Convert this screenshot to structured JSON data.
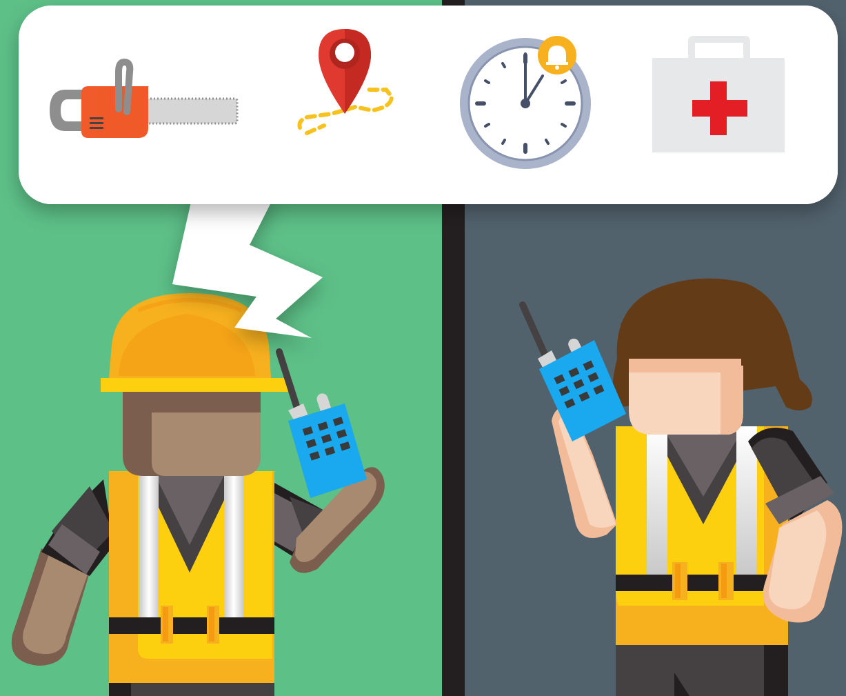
{
  "scene": {
    "panels": [
      {
        "name": "worker-panel",
        "color": "#5dc087"
      },
      {
        "name": "dispatcher-panel",
        "color": "#52626d"
      }
    ],
    "divider_color": "#231f20",
    "speech_bubble": {
      "icons": [
        "chainsaw-icon",
        "location-pin-route-icon",
        "alarm-clock-icon",
        "first-aid-kit-icon"
      ],
      "clock_time": "12:05"
    },
    "characters": [
      {
        "role": "construction-worker",
        "equipment": [
          "hard-hat-icon",
          "safety-vest-icon",
          "walkie-talkie-icon"
        ]
      },
      {
        "role": "dispatcher",
        "equipment": [
          "safety-vest-icon",
          "walkie-talkie-icon"
        ]
      }
    ],
    "colors": {
      "vest": "#fcd00f",
      "vest_shade": "#f7b01e",
      "helmet": "#f7b01e",
      "radio": "#1aa8ee",
      "chainsaw": "#f15a2b",
      "pin": "#e03a30",
      "first_aid_cross": "#e31e25",
      "alarm_bell": "#f7b01e"
    }
  }
}
